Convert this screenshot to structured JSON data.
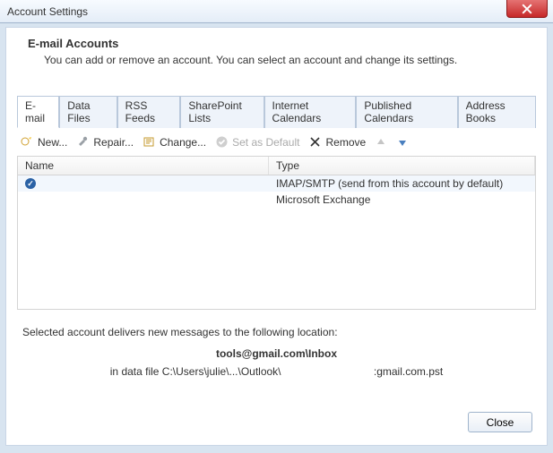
{
  "window": {
    "title": "Account Settings"
  },
  "heading": "E-mail Accounts",
  "description": "You can add or remove an account. You can select an account and change its settings.",
  "tabs": [
    {
      "label": "E-mail"
    },
    {
      "label": "Data Files"
    },
    {
      "label": "RSS Feeds"
    },
    {
      "label": "SharePoint Lists"
    },
    {
      "label": "Internet Calendars"
    },
    {
      "label": "Published Calendars"
    },
    {
      "label": "Address Books"
    }
  ],
  "toolbar": {
    "new": "New...",
    "repair": "Repair...",
    "change": "Change...",
    "set_default": "Set as Default",
    "remove": "Remove"
  },
  "list": {
    "col_name": "Name",
    "col_type": "Type",
    "rows": [
      {
        "name": "",
        "type": "IMAP/SMTP (send from this account by default)",
        "default": true
      },
      {
        "name": "",
        "type": "Microsoft Exchange",
        "default": false
      }
    ]
  },
  "delivery": {
    "intro": "Selected account delivers new messages to the following location:",
    "location_bold": "tools@gmail.com\\Inbox",
    "datafile": "in data file C:\\Users\\julie\\...\\Outlook\\                               :gmail.com.pst"
  },
  "buttons": {
    "close": "Close"
  }
}
